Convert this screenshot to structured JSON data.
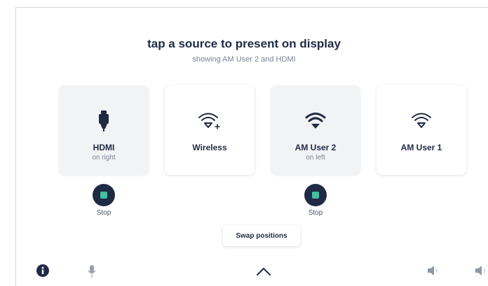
{
  "header": {
    "title": "tap a source to present on display",
    "subtitle": "showing AM User 2 and HDMI"
  },
  "sources": [
    {
      "label": "HDMI",
      "sublabel": "on right",
      "icon": "hdmi-plug-icon",
      "active": true
    },
    {
      "label": "Wireless",
      "sublabel": "",
      "icon": "wifi-plus-icon",
      "active": false
    },
    {
      "label": "AM User 2",
      "sublabel": "on left",
      "icon": "wifi-icon",
      "active": true
    },
    {
      "label": "AM User 1",
      "sublabel": "",
      "icon": "wifi-outline-icon",
      "active": false
    }
  ],
  "stop_buttons": [
    {
      "label": "Stop",
      "for": "HDMI"
    },
    {
      "label": "Stop",
      "for": "AM User 2"
    }
  ],
  "swap_button": {
    "label": "Swap positions"
  },
  "bottom_bar": {
    "icons": [
      "info-icon",
      "microphone-icon",
      "chevron-up-icon",
      "volume-down-icon",
      "volume-up-icon"
    ]
  },
  "colors": {
    "primary": "#1f2a44",
    "accent": "#3fbfa3",
    "muted_text": "#7b8394",
    "active_card_bg": "#f2f3f5"
  }
}
